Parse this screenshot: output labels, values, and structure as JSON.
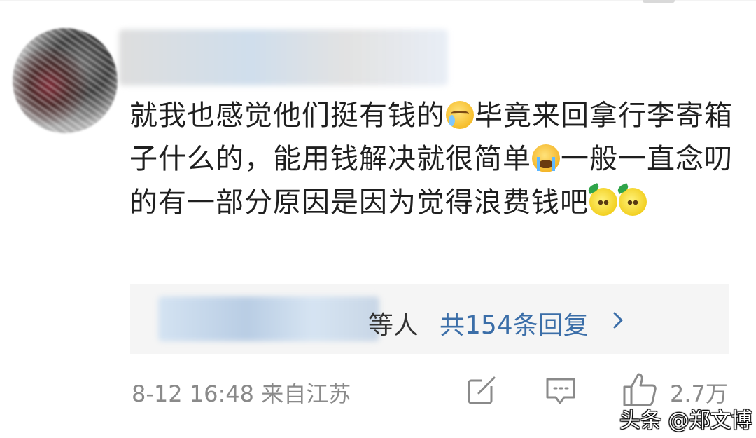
{
  "comment": {
    "text_parts": [
      "就我也感觉他们挺有钱的",
      "毕竟来回拿行李寄箱子什么的，能用钱解决就很简单",
      "一般一直念叨的有一部分原因是因为觉得浪费钱吧"
    ],
    "emojis": [
      "cry-laugh-icon",
      "sob-icon",
      "lemon-icon",
      "lemon-icon"
    ]
  },
  "replies": {
    "suffix": "等人",
    "count_label": "共154条回复"
  },
  "meta": {
    "timestamp": "8-12 16:48 来自江苏",
    "like_count": "2.7万"
  },
  "watermark": "头条 @郑文博",
  "colors": {
    "link": "#3b6ea8",
    "meta_gray": "#8a8a8a",
    "text": "#1f1f1f",
    "reply_bg": "#f5f5f5"
  }
}
